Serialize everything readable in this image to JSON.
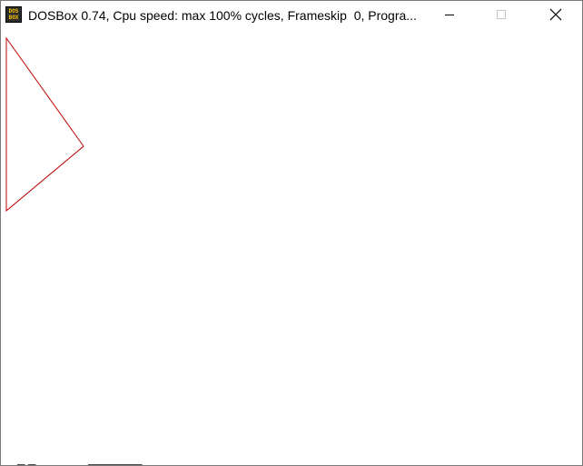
{
  "window": {
    "title": "DOSBox 0.74, Cpu speed: max 100% cycles, Frameskip  0, Progra...",
    "icon": {
      "name": "dosbox-icon",
      "line1": "DOS",
      "line2": "BOX"
    },
    "controls": {
      "minimize_icon": "minimize-icon",
      "maximize_icon": "maximize-icon",
      "close_icon": "close-icon"
    }
  },
  "canvas": {
    "background": "#ffffff",
    "shape": {
      "kind": "triangle-outline",
      "stroke_color": "#c00000"
    }
  },
  "colors": {
    "titlebar": "#ffffff",
    "border": "#7a7a7a",
    "icon_bg": "#2b2b2b",
    "icon_text": "#f5c400",
    "disabled_glyph": "#c6c6c6"
  }
}
